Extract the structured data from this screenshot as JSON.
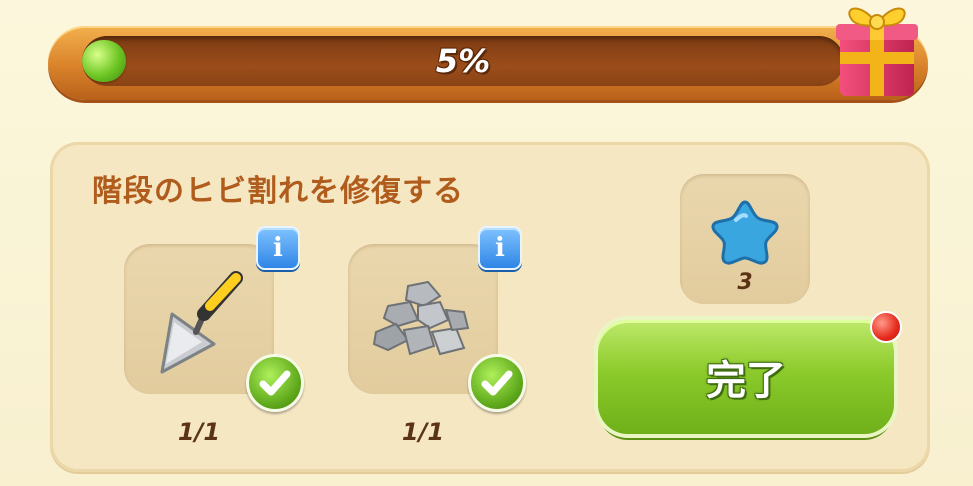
{
  "progress": {
    "percent_label": "5%",
    "fraction": 0.05
  },
  "task": {
    "title": "階段のヒビ割れを修復する",
    "requirements": [
      {
        "item": "trowel",
        "icon": "trowel-icon",
        "count": "1/1",
        "completed": true
      },
      {
        "item": "stones",
        "icon": "stones-icon",
        "count": "1/1",
        "completed": true
      }
    ],
    "reward": {
      "icon": "blue-star-icon",
      "amount": "3"
    },
    "complete_button_label": "完了"
  },
  "colors": {
    "panel": "#f6e7c3",
    "title": "#b05c1c",
    "progress_fill": "#6cc523",
    "button_green": "#8ccb2b",
    "info_blue": "#2f86e6",
    "star_blue": "#3aa6e0",
    "notify_red": "#e52a1c"
  }
}
